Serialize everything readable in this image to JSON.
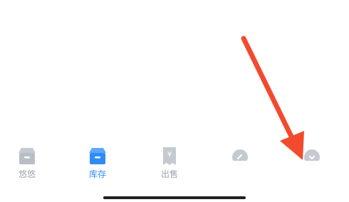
{
  "tabbar": {
    "items": [
      {
        "label": "悠悠",
        "icon": "box-icon",
        "active": false
      },
      {
        "label": "库存",
        "icon": "inventory-box-icon",
        "active": true
      },
      {
        "label": "出售",
        "icon": "sell-receipt-icon",
        "active": false
      },
      {
        "label": "",
        "icon": "message-bubble-icon",
        "active": false
      },
      {
        "label": "",
        "icon": "profile-icon",
        "active": false
      }
    ]
  },
  "colors": {
    "active": "#2f8cf3",
    "inactive": "#9ea3ab",
    "annotation_arrow": "#f24a2e"
  }
}
